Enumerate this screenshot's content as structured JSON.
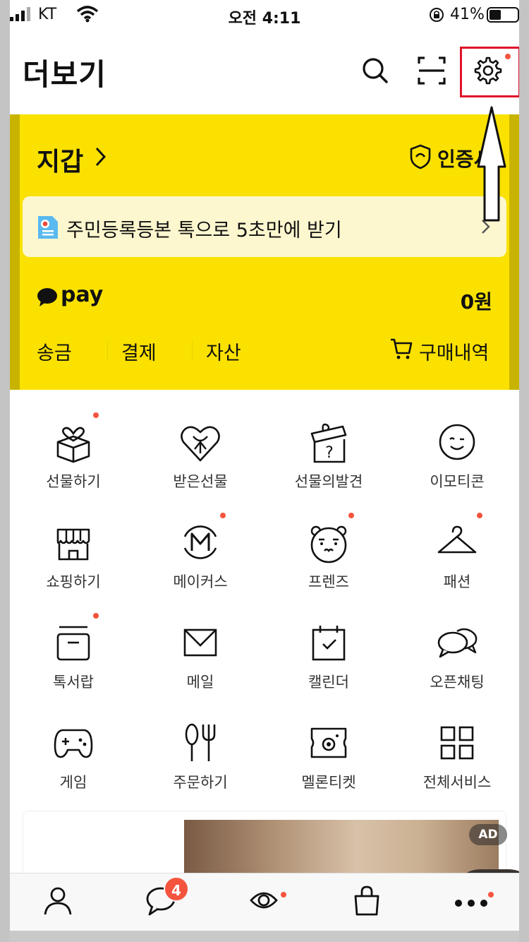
{
  "status_bar": {
    "carrier": "KT",
    "time": "오전 4:11",
    "battery_percent": "41%"
  },
  "header": {
    "title": "더보기",
    "icons": [
      "search-icon",
      "scan-icon",
      "settings-icon"
    ]
  },
  "wallet": {
    "title": "지갑",
    "certificate_label": "인증서",
    "banner_text": "주민등록등본 톡으로 5초만에 받기",
    "pay_label": "pay",
    "pay_amount": "0원",
    "links": [
      "송금",
      "결제",
      "자산"
    ],
    "purchase_history": "구매내역",
    "accent_color": "#fae100"
  },
  "services": [
    {
      "label": "선물하기",
      "icon": "gift-box-icon",
      "dot": true
    },
    {
      "label": "받은선물",
      "icon": "heart-gift-icon",
      "dot": false
    },
    {
      "label": "선물의발견",
      "icon": "mystery-gift-icon",
      "dot": false
    },
    {
      "label": "이모티콘",
      "icon": "emoticon-icon",
      "dot": false
    },
    {
      "label": "쇼핑하기",
      "icon": "shop-icon",
      "dot": false
    },
    {
      "label": "메이커스",
      "icon": "makers-icon",
      "dot": true
    },
    {
      "label": "프렌즈",
      "icon": "ryan-bear-icon",
      "dot": true
    },
    {
      "label": "패션",
      "icon": "hanger-icon",
      "dot": true
    },
    {
      "label": "톡서랍",
      "icon": "drawer-icon",
      "dot": true
    },
    {
      "label": "메일",
      "icon": "mail-icon",
      "dot": false
    },
    {
      "label": "캘린더",
      "icon": "calendar-icon",
      "dot": false
    },
    {
      "label": "오픈채팅",
      "icon": "open-chat-icon",
      "dot": false
    },
    {
      "label": "게임",
      "icon": "gamepad-icon",
      "dot": false
    },
    {
      "label": "주문하기",
      "icon": "utensils-icon",
      "dot": false
    },
    {
      "label": "멜론티켓",
      "icon": "ticket-icon",
      "dot": false
    },
    {
      "label": "전체서비스",
      "icon": "grid-icon",
      "dot": false
    }
  ],
  "ad": {
    "badge": "AD"
  },
  "tabbar": {
    "chat_badge": "4",
    "tabs": [
      "friends-icon",
      "chat-icon",
      "view-icon",
      "shopping-icon",
      "more-icon"
    ]
  },
  "colors": {
    "dot": "#f4543e",
    "highlight_box": "#e0112b"
  }
}
